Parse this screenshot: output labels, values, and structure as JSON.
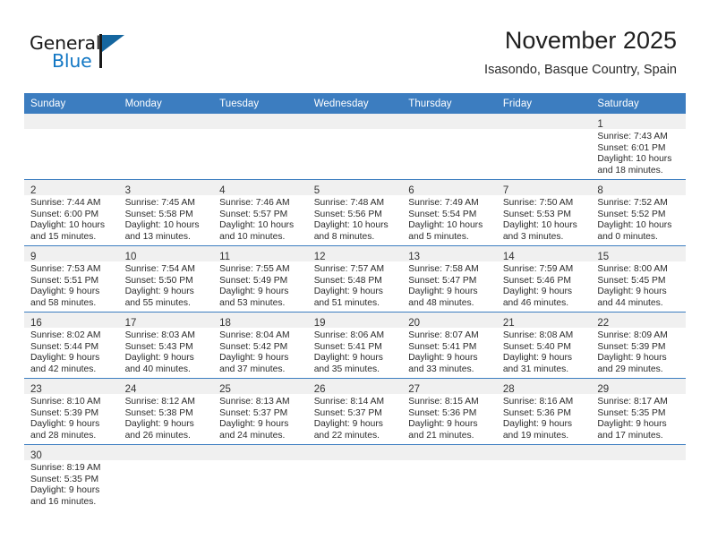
{
  "logo": {
    "word_top": "General",
    "word_bottom": "Blue",
    "flag_color": "#15669f",
    "blue_text_color": "#1277c4"
  },
  "header": {
    "title": "November 2025",
    "subtitle": "Isasondo, Basque Country, Spain"
  },
  "theme": {
    "header_blue": "#3c7dc0",
    "daynum_band": "#f0f0f0",
    "text": "#2b2b2b"
  },
  "calendar": {
    "weekday_headers": [
      "Sunday",
      "Monday",
      "Tuesday",
      "Wednesday",
      "Thursday",
      "Friday",
      "Saturday"
    ],
    "weeks": [
      [
        {
          "empty": true
        },
        {
          "empty": true
        },
        {
          "empty": true
        },
        {
          "empty": true
        },
        {
          "empty": true
        },
        {
          "empty": true
        },
        {
          "day": "1",
          "sunrise": "Sunrise: 7:43 AM",
          "sunset": "Sunset: 6:01 PM",
          "daylight_1": "Daylight: 10 hours",
          "daylight_2": "and 18 minutes."
        }
      ],
      [
        {
          "day": "2",
          "sunrise": "Sunrise: 7:44 AM",
          "sunset": "Sunset: 6:00 PM",
          "daylight_1": "Daylight: 10 hours",
          "daylight_2": "and 15 minutes."
        },
        {
          "day": "3",
          "sunrise": "Sunrise: 7:45 AM",
          "sunset": "Sunset: 5:58 PM",
          "daylight_1": "Daylight: 10 hours",
          "daylight_2": "and 13 minutes."
        },
        {
          "day": "4",
          "sunrise": "Sunrise: 7:46 AM",
          "sunset": "Sunset: 5:57 PM",
          "daylight_1": "Daylight: 10 hours",
          "daylight_2": "and 10 minutes."
        },
        {
          "day": "5",
          "sunrise": "Sunrise: 7:48 AM",
          "sunset": "Sunset: 5:56 PM",
          "daylight_1": "Daylight: 10 hours",
          "daylight_2": "and 8 minutes."
        },
        {
          "day": "6",
          "sunrise": "Sunrise: 7:49 AM",
          "sunset": "Sunset: 5:54 PM",
          "daylight_1": "Daylight: 10 hours",
          "daylight_2": "and 5 minutes."
        },
        {
          "day": "7",
          "sunrise": "Sunrise: 7:50 AM",
          "sunset": "Sunset: 5:53 PM",
          "daylight_1": "Daylight: 10 hours",
          "daylight_2": "and 3 minutes."
        },
        {
          "day": "8",
          "sunrise": "Sunrise: 7:52 AM",
          "sunset": "Sunset: 5:52 PM",
          "daylight_1": "Daylight: 10 hours",
          "daylight_2": "and 0 minutes."
        }
      ],
      [
        {
          "day": "9",
          "sunrise": "Sunrise: 7:53 AM",
          "sunset": "Sunset: 5:51 PM",
          "daylight_1": "Daylight: 9 hours",
          "daylight_2": "and 58 minutes."
        },
        {
          "day": "10",
          "sunrise": "Sunrise: 7:54 AM",
          "sunset": "Sunset: 5:50 PM",
          "daylight_1": "Daylight: 9 hours",
          "daylight_2": "and 55 minutes."
        },
        {
          "day": "11",
          "sunrise": "Sunrise: 7:55 AM",
          "sunset": "Sunset: 5:49 PM",
          "daylight_1": "Daylight: 9 hours",
          "daylight_2": "and 53 minutes."
        },
        {
          "day": "12",
          "sunrise": "Sunrise: 7:57 AM",
          "sunset": "Sunset: 5:48 PM",
          "daylight_1": "Daylight: 9 hours",
          "daylight_2": "and 51 minutes."
        },
        {
          "day": "13",
          "sunrise": "Sunrise: 7:58 AM",
          "sunset": "Sunset: 5:47 PM",
          "daylight_1": "Daylight: 9 hours",
          "daylight_2": "and 48 minutes."
        },
        {
          "day": "14",
          "sunrise": "Sunrise: 7:59 AM",
          "sunset": "Sunset: 5:46 PM",
          "daylight_1": "Daylight: 9 hours",
          "daylight_2": "and 46 minutes."
        },
        {
          "day": "15",
          "sunrise": "Sunrise: 8:00 AM",
          "sunset": "Sunset: 5:45 PM",
          "daylight_1": "Daylight: 9 hours",
          "daylight_2": "and 44 minutes."
        }
      ],
      [
        {
          "day": "16",
          "sunrise": "Sunrise: 8:02 AM",
          "sunset": "Sunset: 5:44 PM",
          "daylight_1": "Daylight: 9 hours",
          "daylight_2": "and 42 minutes."
        },
        {
          "day": "17",
          "sunrise": "Sunrise: 8:03 AM",
          "sunset": "Sunset: 5:43 PM",
          "daylight_1": "Daylight: 9 hours",
          "daylight_2": "and 40 minutes."
        },
        {
          "day": "18",
          "sunrise": "Sunrise: 8:04 AM",
          "sunset": "Sunset: 5:42 PM",
          "daylight_1": "Daylight: 9 hours",
          "daylight_2": "and 37 minutes."
        },
        {
          "day": "19",
          "sunrise": "Sunrise: 8:06 AM",
          "sunset": "Sunset: 5:41 PM",
          "daylight_1": "Daylight: 9 hours",
          "daylight_2": "and 35 minutes."
        },
        {
          "day": "20",
          "sunrise": "Sunrise: 8:07 AM",
          "sunset": "Sunset: 5:41 PM",
          "daylight_1": "Daylight: 9 hours",
          "daylight_2": "and 33 minutes."
        },
        {
          "day": "21",
          "sunrise": "Sunrise: 8:08 AM",
          "sunset": "Sunset: 5:40 PM",
          "daylight_1": "Daylight: 9 hours",
          "daylight_2": "and 31 minutes."
        },
        {
          "day": "22",
          "sunrise": "Sunrise: 8:09 AM",
          "sunset": "Sunset: 5:39 PM",
          "daylight_1": "Daylight: 9 hours",
          "daylight_2": "and 29 minutes."
        }
      ],
      [
        {
          "day": "23",
          "sunrise": "Sunrise: 8:10 AM",
          "sunset": "Sunset: 5:39 PM",
          "daylight_1": "Daylight: 9 hours",
          "daylight_2": "and 28 minutes."
        },
        {
          "day": "24",
          "sunrise": "Sunrise: 8:12 AM",
          "sunset": "Sunset: 5:38 PM",
          "daylight_1": "Daylight: 9 hours",
          "daylight_2": "and 26 minutes."
        },
        {
          "day": "25",
          "sunrise": "Sunrise: 8:13 AM",
          "sunset": "Sunset: 5:37 PM",
          "daylight_1": "Daylight: 9 hours",
          "daylight_2": "and 24 minutes."
        },
        {
          "day": "26",
          "sunrise": "Sunrise: 8:14 AM",
          "sunset": "Sunset: 5:37 PM",
          "daylight_1": "Daylight: 9 hours",
          "daylight_2": "and 22 minutes."
        },
        {
          "day": "27",
          "sunrise": "Sunrise: 8:15 AM",
          "sunset": "Sunset: 5:36 PM",
          "daylight_1": "Daylight: 9 hours",
          "daylight_2": "and 21 minutes."
        },
        {
          "day": "28",
          "sunrise": "Sunrise: 8:16 AM",
          "sunset": "Sunset: 5:36 PM",
          "daylight_1": "Daylight: 9 hours",
          "daylight_2": "and 19 minutes."
        },
        {
          "day": "29",
          "sunrise": "Sunrise: 8:17 AM",
          "sunset": "Sunset: 5:35 PM",
          "daylight_1": "Daylight: 9 hours",
          "daylight_2": "and 17 minutes."
        }
      ],
      [
        {
          "day": "30",
          "sunrise": "Sunrise: 8:19 AM",
          "sunset": "Sunset: 5:35 PM",
          "daylight_1": "Daylight: 9 hours",
          "daylight_2": "and 16 minutes."
        },
        {
          "empty": true
        },
        {
          "empty": true
        },
        {
          "empty": true
        },
        {
          "empty": true
        },
        {
          "empty": true
        },
        {
          "empty": true
        }
      ]
    ]
  }
}
